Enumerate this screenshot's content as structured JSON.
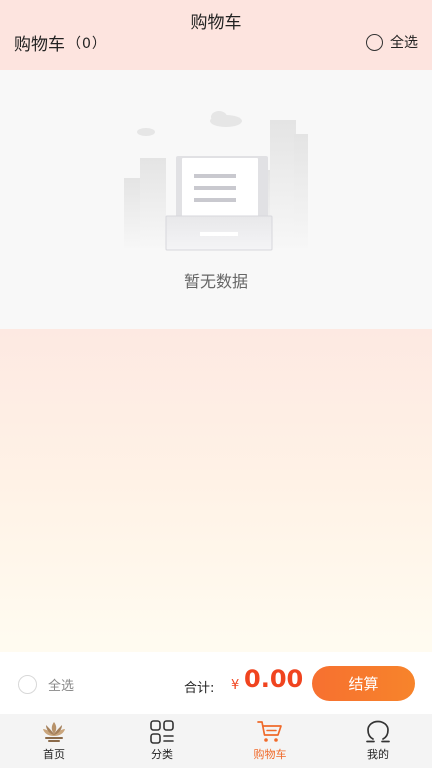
{
  "header": {
    "nav_title": "购物车",
    "cart_title": "购物车",
    "cart_count": "（0）",
    "select_all_label": "全选"
  },
  "empty_state": {
    "message": "暂无数据",
    "icon": "empty-document-illustration"
  },
  "bottom_bar": {
    "select_all_label": "全选",
    "total_label": "合计:",
    "currency_symbol": "¥",
    "total_amount": "0.00",
    "checkout_label": "结算"
  },
  "tabbar": {
    "items": [
      {
        "label": "首页",
        "icon": "home-lotus-icon",
        "active": false
      },
      {
        "label": "分类",
        "icon": "category-grid-icon",
        "active": false
      },
      {
        "label": "购物车",
        "icon": "cart-icon",
        "active": true
      },
      {
        "label": "我的",
        "icon": "profile-icon",
        "active": false
      }
    ]
  },
  "colors": {
    "accent": "#f06a2a",
    "price": "#f0441f",
    "header_bg": "#fde4df"
  }
}
